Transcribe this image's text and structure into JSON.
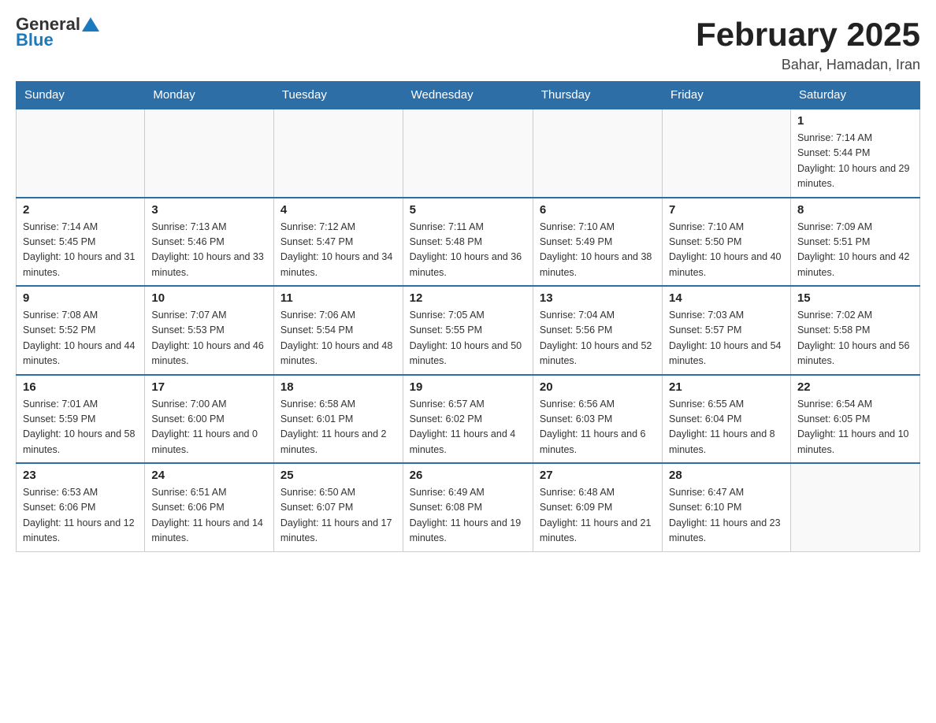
{
  "header": {
    "logo_general": "General",
    "logo_blue": "Blue",
    "month_title": "February 2025",
    "location": "Bahar, Hamadan, Iran"
  },
  "days_of_week": [
    "Sunday",
    "Monday",
    "Tuesday",
    "Wednesday",
    "Thursday",
    "Friday",
    "Saturday"
  ],
  "weeks": [
    [
      null,
      null,
      null,
      null,
      null,
      null,
      {
        "day": "1",
        "sunrise": "Sunrise: 7:14 AM",
        "sunset": "Sunset: 5:44 PM",
        "daylight": "Daylight: 10 hours and 29 minutes."
      }
    ],
    [
      {
        "day": "2",
        "sunrise": "Sunrise: 7:14 AM",
        "sunset": "Sunset: 5:45 PM",
        "daylight": "Daylight: 10 hours and 31 minutes."
      },
      {
        "day": "3",
        "sunrise": "Sunrise: 7:13 AM",
        "sunset": "Sunset: 5:46 PM",
        "daylight": "Daylight: 10 hours and 33 minutes."
      },
      {
        "day": "4",
        "sunrise": "Sunrise: 7:12 AM",
        "sunset": "Sunset: 5:47 PM",
        "daylight": "Daylight: 10 hours and 34 minutes."
      },
      {
        "day": "5",
        "sunrise": "Sunrise: 7:11 AM",
        "sunset": "Sunset: 5:48 PM",
        "daylight": "Daylight: 10 hours and 36 minutes."
      },
      {
        "day": "6",
        "sunrise": "Sunrise: 7:10 AM",
        "sunset": "Sunset: 5:49 PM",
        "daylight": "Daylight: 10 hours and 38 minutes."
      },
      {
        "day": "7",
        "sunrise": "Sunrise: 7:10 AM",
        "sunset": "Sunset: 5:50 PM",
        "daylight": "Daylight: 10 hours and 40 minutes."
      },
      {
        "day": "8",
        "sunrise": "Sunrise: 7:09 AM",
        "sunset": "Sunset: 5:51 PM",
        "daylight": "Daylight: 10 hours and 42 minutes."
      }
    ],
    [
      {
        "day": "9",
        "sunrise": "Sunrise: 7:08 AM",
        "sunset": "Sunset: 5:52 PM",
        "daylight": "Daylight: 10 hours and 44 minutes."
      },
      {
        "day": "10",
        "sunrise": "Sunrise: 7:07 AM",
        "sunset": "Sunset: 5:53 PM",
        "daylight": "Daylight: 10 hours and 46 minutes."
      },
      {
        "day": "11",
        "sunrise": "Sunrise: 7:06 AM",
        "sunset": "Sunset: 5:54 PM",
        "daylight": "Daylight: 10 hours and 48 minutes."
      },
      {
        "day": "12",
        "sunrise": "Sunrise: 7:05 AM",
        "sunset": "Sunset: 5:55 PM",
        "daylight": "Daylight: 10 hours and 50 minutes."
      },
      {
        "day": "13",
        "sunrise": "Sunrise: 7:04 AM",
        "sunset": "Sunset: 5:56 PM",
        "daylight": "Daylight: 10 hours and 52 minutes."
      },
      {
        "day": "14",
        "sunrise": "Sunrise: 7:03 AM",
        "sunset": "Sunset: 5:57 PM",
        "daylight": "Daylight: 10 hours and 54 minutes."
      },
      {
        "day": "15",
        "sunrise": "Sunrise: 7:02 AM",
        "sunset": "Sunset: 5:58 PM",
        "daylight": "Daylight: 10 hours and 56 minutes."
      }
    ],
    [
      {
        "day": "16",
        "sunrise": "Sunrise: 7:01 AM",
        "sunset": "Sunset: 5:59 PM",
        "daylight": "Daylight: 10 hours and 58 minutes."
      },
      {
        "day": "17",
        "sunrise": "Sunrise: 7:00 AM",
        "sunset": "Sunset: 6:00 PM",
        "daylight": "Daylight: 11 hours and 0 minutes."
      },
      {
        "day": "18",
        "sunrise": "Sunrise: 6:58 AM",
        "sunset": "Sunset: 6:01 PM",
        "daylight": "Daylight: 11 hours and 2 minutes."
      },
      {
        "day": "19",
        "sunrise": "Sunrise: 6:57 AM",
        "sunset": "Sunset: 6:02 PM",
        "daylight": "Daylight: 11 hours and 4 minutes."
      },
      {
        "day": "20",
        "sunrise": "Sunrise: 6:56 AM",
        "sunset": "Sunset: 6:03 PM",
        "daylight": "Daylight: 11 hours and 6 minutes."
      },
      {
        "day": "21",
        "sunrise": "Sunrise: 6:55 AM",
        "sunset": "Sunset: 6:04 PM",
        "daylight": "Daylight: 11 hours and 8 minutes."
      },
      {
        "day": "22",
        "sunrise": "Sunrise: 6:54 AM",
        "sunset": "Sunset: 6:05 PM",
        "daylight": "Daylight: 11 hours and 10 minutes."
      }
    ],
    [
      {
        "day": "23",
        "sunrise": "Sunrise: 6:53 AM",
        "sunset": "Sunset: 6:06 PM",
        "daylight": "Daylight: 11 hours and 12 minutes."
      },
      {
        "day": "24",
        "sunrise": "Sunrise: 6:51 AM",
        "sunset": "Sunset: 6:06 PM",
        "daylight": "Daylight: 11 hours and 14 minutes."
      },
      {
        "day": "25",
        "sunrise": "Sunrise: 6:50 AM",
        "sunset": "Sunset: 6:07 PM",
        "daylight": "Daylight: 11 hours and 17 minutes."
      },
      {
        "day": "26",
        "sunrise": "Sunrise: 6:49 AM",
        "sunset": "Sunset: 6:08 PM",
        "daylight": "Daylight: 11 hours and 19 minutes."
      },
      {
        "day": "27",
        "sunrise": "Sunrise: 6:48 AM",
        "sunset": "Sunset: 6:09 PM",
        "daylight": "Daylight: 11 hours and 21 minutes."
      },
      {
        "day": "28",
        "sunrise": "Sunrise: 6:47 AM",
        "sunset": "Sunset: 6:10 PM",
        "daylight": "Daylight: 11 hours and 23 minutes."
      },
      null
    ]
  ]
}
